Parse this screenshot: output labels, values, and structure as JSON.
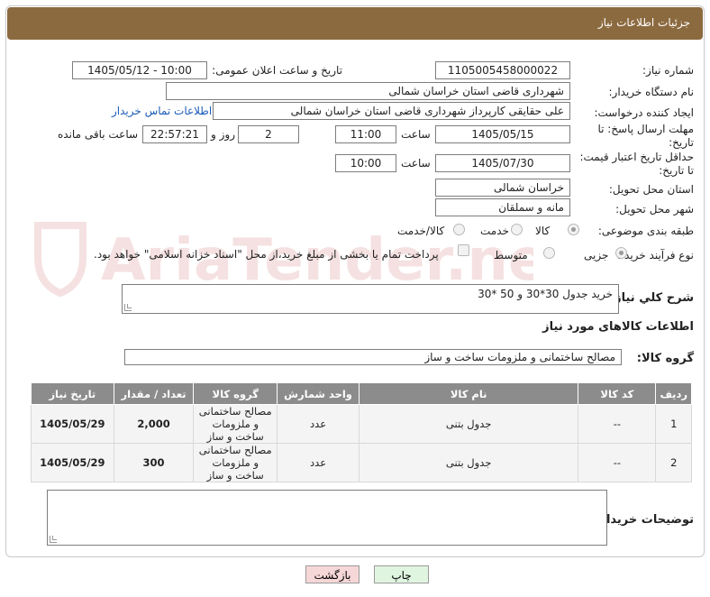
{
  "header": {
    "title": "جزئیات اطلاعات نیاز"
  },
  "fields": {
    "need_number_label": "شماره نیاز:",
    "need_number": "1105005458000022",
    "announce_label": "تاریخ و ساعت اعلان عمومی:",
    "announce_value": "1405/05/12 - 10:00",
    "buyer_org_label": "نام دستگاه خریدار:",
    "buyer_org": "شهرداری قاضی استان خراسان شمالی",
    "creator_label": "ایجاد کننده درخواست:",
    "creator": "علی  حقایقی  کارپرداز  شهرداری قاضی استان خراسان شمالی",
    "contact_link": "اطلاعات تماس خریدار",
    "send_deadline_label_1": "مهلت ارسال پاسخ: تا",
    "send_deadline_label_2": "تاریخ:",
    "send_date": "1405/05/15",
    "time_label": "ساعت",
    "send_time": "11:00",
    "days_value": "2",
    "days_label": "روز و",
    "remaining_time": "22:57:21",
    "remaining_label": "ساعت باقی مانده",
    "validity_label_1": "حداقل تاریخ اعتبار قیمت:",
    "validity_label_2": "تا تاریخ:",
    "validity_date": "1405/07/30",
    "validity_time": "10:00",
    "province_label": "استان محل تحویل:",
    "province": "خراسان شمالی",
    "city_label": "شهر محل تحویل:",
    "city": "مانه و سملقان",
    "category_label": "طبقه بندی موضوعی:",
    "category_options": [
      "کالا",
      "خدمت",
      "کالا/خدمت"
    ],
    "process_label": "نوع فرآیند خرید :",
    "process_options": [
      "جزیی",
      "متوسط"
    ],
    "payment_note": "پرداخت تمام یا بخشی از مبلغ خرید،از محل \"اسناد خزانه اسلامی\" خواهد بود.",
    "description_label": "شرح کلي نياز:",
    "description": "خرید جدول 30*30 و 50 *30",
    "goods_info_title": "اطلاعات کالاهای مورد نیاز",
    "goods_group_label": "گروه کالا:",
    "goods_group": "مصالح ساختمانی و ملزومات ساخت و ساز",
    "buyer_notes_label": "توضیحات خریدار:"
  },
  "table": {
    "headers": [
      "ردیف",
      "کد کالا",
      "نام کالا",
      "واحد شمارش",
      "گروه کالا",
      "تعداد / مقدار",
      "تاریخ نیاز"
    ],
    "rows": [
      [
        "1",
        "--",
        "جدول بتنی",
        "عدد",
        "مصالح ساختمانی و ملزومات ساخت و ساز",
        "2,000",
        "1405/05/29"
      ],
      [
        "2",
        "--",
        "جدول بتنی",
        "عدد",
        "مصالح ساختمانی و ملزومات ساخت و ساز",
        "300",
        "1405/05/29"
      ]
    ]
  },
  "buttons": {
    "print": "چاپ",
    "back": "بازگشت"
  },
  "watermark": "AriaTender.net"
}
